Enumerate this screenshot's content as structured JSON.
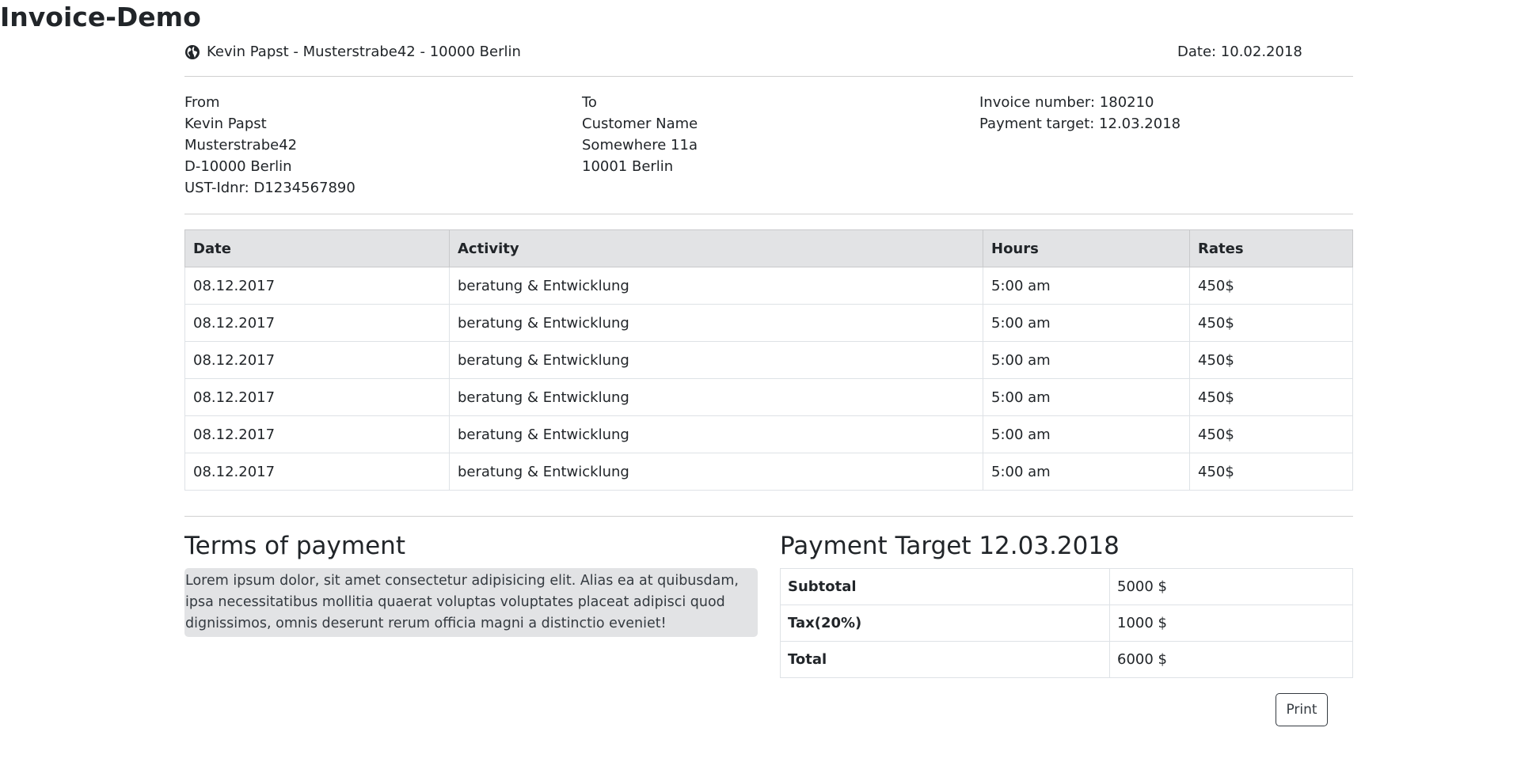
{
  "page": {
    "title": "Invoice-Demo"
  },
  "header": {
    "sender_line": "Kevin Papst - Musterstrabe42 - 10000 Berlin",
    "date_line": "Date: 10.02.2018"
  },
  "from": {
    "label": "From",
    "lines": [
      "Kevin Papst",
      "Musterstrabe42",
      "D-10000 Berlin",
      "UST-Idnr: D1234567890"
    ]
  },
  "to": {
    "label": "To",
    "lines": [
      "Customer Name",
      "Somewhere 11a",
      "10001 Berlin"
    ]
  },
  "invoice": {
    "number": "Invoice number: 180210",
    "target": "Payment target: 12.03.2018"
  },
  "table": {
    "headers": [
      "Date",
      "Activity",
      "Hours",
      "Rates"
    ],
    "rows": [
      [
        "08.12.2017",
        "beratung & Entwicklung",
        "5:00 am",
        "450$"
      ],
      [
        "08.12.2017",
        "beratung & Entwicklung",
        "5:00 am",
        "450$"
      ],
      [
        "08.12.2017",
        "beratung & Entwicklung",
        "5:00 am",
        "450$"
      ],
      [
        "08.12.2017",
        "beratung & Entwicklung",
        "5:00 am",
        "450$"
      ],
      [
        "08.12.2017",
        "beratung & Entwicklung",
        "5:00 am",
        "450$"
      ],
      [
        "08.12.2017",
        "beratung & Entwicklung",
        "5:00 am",
        "450$"
      ]
    ]
  },
  "terms": {
    "title": "Terms of payment",
    "text": "Lorem ipsum dolor, sit amet consectetur adipisicing elit. Alias ea at quibusdam, ipsa necessitatibus mollitia quaerat voluptas voluptates placeat adipisci quod dignissimos, omnis deserunt rerum officia magni a distinctio eveniet!"
  },
  "summary": {
    "title": "Payment Target 12.03.2018",
    "rows": [
      {
        "label": "Subtotal",
        "value": "5000 $"
      },
      {
        "label": "Tax(20%)",
        "value": "1000 $"
      },
      {
        "label": "Total",
        "value": "6000 $"
      }
    ]
  },
  "actions": {
    "print_label": "Print"
  },
  "icons": {
    "sender": "globe-icon"
  }
}
